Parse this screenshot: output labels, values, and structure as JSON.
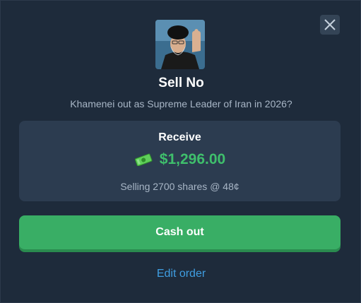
{
  "modal": {
    "title": "Sell No",
    "question": "Khamenei out as Supreme Leader of Iran in 2026?",
    "close_icon": "close-icon",
    "avatar_icon": "market-avatar"
  },
  "receive": {
    "label": "Receive",
    "amount": "$1,296.00",
    "amount_icon": "money-icon",
    "details": "Selling 2700 shares @ 48¢"
  },
  "actions": {
    "cash_out_label": "Cash out",
    "edit_order_label": "Edit order"
  },
  "colors": {
    "background": "#1e2b3b",
    "accent_green": "#39ae65",
    "amount_green": "#3fbf6c",
    "link_blue": "#3f9ee2"
  }
}
